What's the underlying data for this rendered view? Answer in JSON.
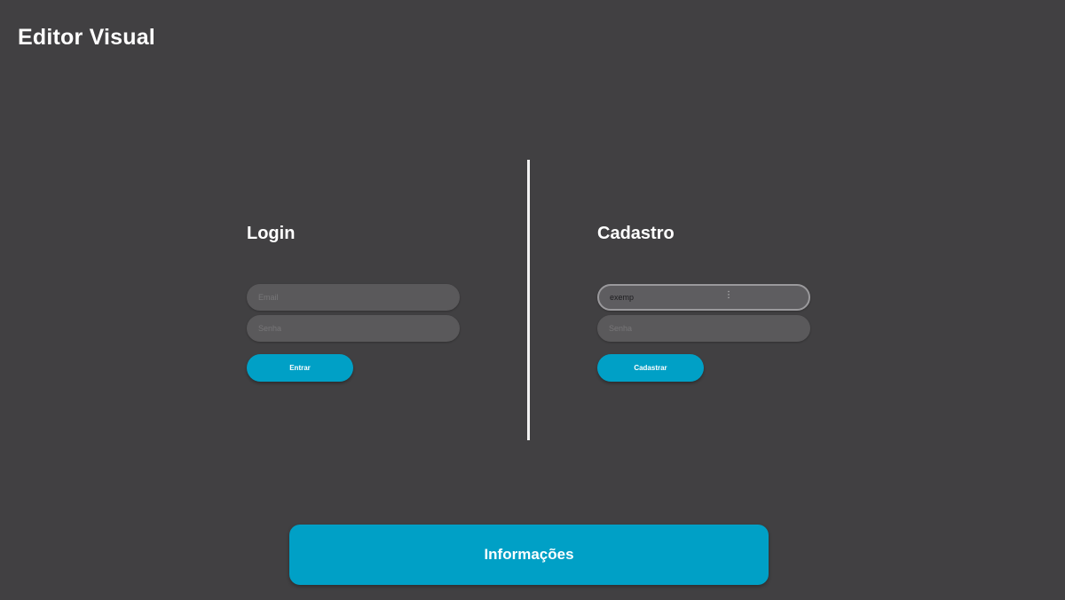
{
  "app": {
    "title": "Editor Visual"
  },
  "login": {
    "title": "Login",
    "email_placeholder": "Email",
    "password_placeholder": "Senha",
    "submit_label": "Entrar"
  },
  "signup": {
    "title": "Cadastro",
    "email_value": "exemp",
    "password_placeholder": "Senha",
    "submit_label": "Cadastrar"
  },
  "footer": {
    "info_label": "Informações"
  },
  "colors": {
    "background": "#414042",
    "accent": "#00a0c6",
    "field": "#5a595b",
    "text": "#ffffff"
  }
}
